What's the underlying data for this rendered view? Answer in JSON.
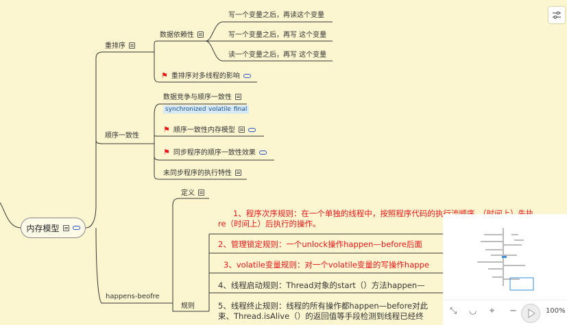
{
  "colors": {
    "background": "#fbf6cf",
    "line": "#333333",
    "red": "#e8141a",
    "link": "#2b56c8",
    "tag_bg": "#d6e9f7",
    "tag_text": "#1e4f8c"
  },
  "root": {
    "label": "内存模型"
  },
  "branches": {
    "reorder": {
      "label": "重排序"
    },
    "data_dependency": {
      "label": "数据依赖性"
    },
    "leaf_write_read": "写一个变量之后，再读这个变量",
    "leaf_write_write": "写一个变量之后，再写 这个变量",
    "leaf_read_write": "读一个变量之后，再写 这个变量",
    "reorder_effect": {
      "label": "重排序对多线程的影响"
    },
    "consistency": {
      "label": "顺序一致性"
    },
    "data_race": {
      "label": "数据竞争与顺序一致性"
    },
    "tags": [
      "synchronized",
      "volatile",
      "final"
    ],
    "seq_memory_model": {
      "label": "顺序一致性内存模型"
    },
    "sync_effect": {
      "label": "同步程序的顺序一致性效果"
    },
    "unsync_traits": {
      "label": "未同步程序的执行特性"
    },
    "happens": {
      "label": "happens-beofre"
    },
    "definition": {
      "label": "定义"
    },
    "rules": {
      "label": "规则"
    },
    "rule1_line1": "1、程序次序规则：在一个单独的线程中，按照程序代码的执行流顺序，（时间上）先执",
    "rule1_line2": "re（时间上）后执行的操作。",
    "rule2": "2、管理锁定规则：一个unlock操作happen—before后面",
    "rule3": "3、volatile变量规则：对一个volatile变量的写操作happe",
    "rule4": "4、线程启动规则：Thread对象的start（）方法happen—",
    "rule5_line1": "5、线程终止规则：线程的所有操作都happen—before对此",
    "rule5_line2": "束、Thread.isAlive（）的返回值等手段检测到线程已经终"
  },
  "toolbar": {
    "zoom": "100%"
  },
  "icons": {
    "settings": "sliders-icon",
    "fit": "expand-arrows-icon",
    "eye": "eye-closed-icon",
    "location": "location-pin-icon",
    "minus": "minus-icon",
    "plus": "plus-icon",
    "play": "play-icon",
    "note": "note-icon",
    "link": "link-icon",
    "flag": "flag-icon"
  }
}
